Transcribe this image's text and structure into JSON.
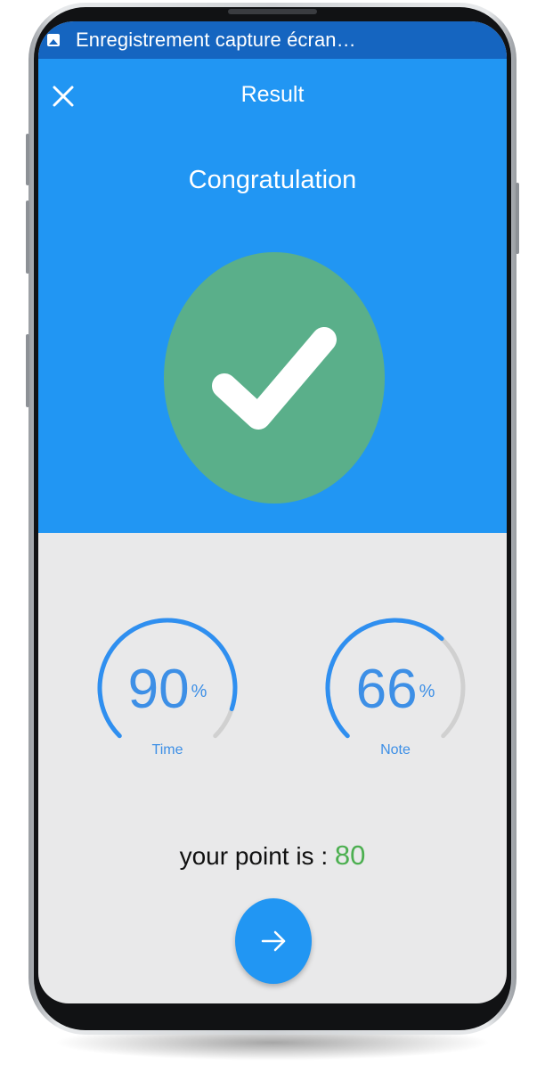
{
  "status_bar": {
    "notification_text": "Enregistrement capture écran…",
    "icon": "image-icon"
  },
  "header": {
    "title": "Result",
    "close_icon": "close-icon",
    "background_color": "#2196f3"
  },
  "result": {
    "message": "Congratulation",
    "success_icon": "checkmark-icon",
    "circle_color": "#5aaf8a"
  },
  "stats": [
    {
      "value": "90",
      "unit": "%",
      "label": "Time",
      "fraction": 0.9
    },
    {
      "value": "66",
      "unit": "%",
      "label": "Note",
      "fraction": 0.66
    }
  ],
  "points": {
    "label": "your point is : ",
    "value": "80",
    "value_color": "#4caf50"
  },
  "next_button": {
    "icon": "arrow-right-icon"
  }
}
